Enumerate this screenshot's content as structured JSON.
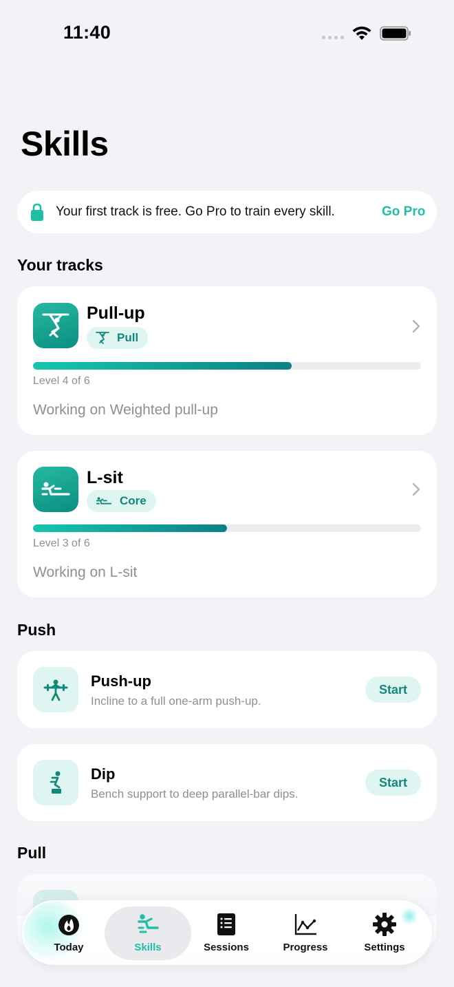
{
  "status_bar": {
    "time": "11:40"
  },
  "page": {
    "title": "Skills"
  },
  "banner": {
    "text": "Your first track is free. Go Pro to train every skill.",
    "cta": "Go Pro",
    "icon": "lock-icon"
  },
  "sections": {
    "your_tracks": "Your tracks",
    "push": "Push",
    "pull": "Pull"
  },
  "tracks": [
    {
      "name": "Pull-up",
      "category": "Pull",
      "level_text": "Level 4 of 6",
      "progress": 0.667,
      "working_on": "Working on Weighted pull-up",
      "icon": "pull-up-figure-icon"
    },
    {
      "name": "L-sit",
      "category": "Core",
      "level_text": "Level 3 of 6",
      "progress": 0.5,
      "working_on": "Working on L-sit",
      "icon": "l-sit-figure-icon"
    }
  ],
  "push_skills": [
    {
      "name": "Push-up",
      "description": "Incline to a full one-arm push-up.",
      "action": "Start",
      "icon": "push-up-figure-icon"
    },
    {
      "name": "Dip",
      "description": "Bench support to deep parallel-bar dips.",
      "action": "Start",
      "icon": "dip-figure-icon"
    }
  ],
  "tab_bar": {
    "tabs": [
      {
        "label": "Today",
        "icon": "flame-icon",
        "active": false
      },
      {
        "label": "Skills",
        "icon": "skills-figure-icon",
        "active": true
      },
      {
        "label": "Sessions",
        "icon": "list-book-icon",
        "active": false
      },
      {
        "label": "Progress",
        "icon": "line-chart-icon",
        "active": false
      },
      {
        "label": "Settings",
        "icon": "gear-icon",
        "active": false
      }
    ]
  },
  "colors": {
    "accent": "#1fbfa6",
    "accent_dark": "#13877a",
    "pill_bg": "#dff5f1",
    "background": "#f2f2f7"
  }
}
